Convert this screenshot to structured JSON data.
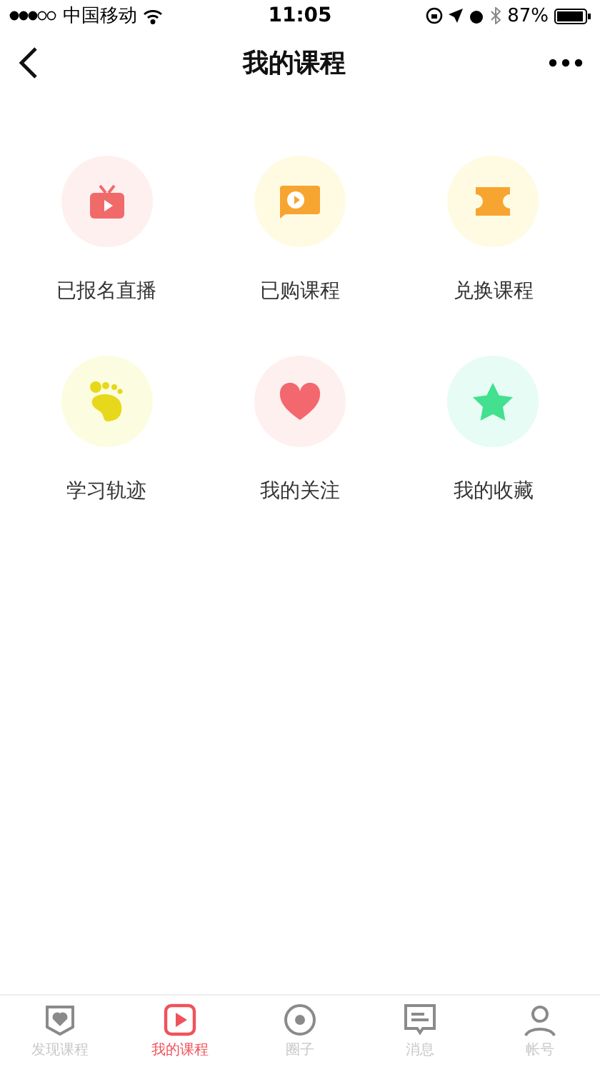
{
  "status_bar": {
    "carrier": "中国移动",
    "time": "11:05",
    "battery": "87%"
  },
  "nav": {
    "title": "我的课程"
  },
  "menu": [
    {
      "kind": "tv",
      "label": "已报名直播",
      "color": "#fff0f0"
    },
    {
      "kind": "video",
      "label": "已购课程",
      "color": "#fffbe3"
    },
    {
      "kind": "ticket",
      "label": "兑换课程",
      "color": "#fffbe3"
    },
    {
      "kind": "foot",
      "label": "学习轨迹",
      "color": "#fcfde0"
    },
    {
      "kind": "heart",
      "label": "我的关注",
      "color": "#fff0f0"
    },
    {
      "kind": "star",
      "label": "我的收藏",
      "color": "#e6fcf4"
    }
  ],
  "tabs": [
    {
      "kind": "discover",
      "label": "发现课程",
      "selected": false
    },
    {
      "kind": "course",
      "label": "我的课程",
      "selected": true
    },
    {
      "kind": "circle",
      "label": "圈子",
      "selected": false
    },
    {
      "kind": "message",
      "label": "消息",
      "selected": false
    },
    {
      "kind": "account",
      "label": "帐号",
      "selected": false
    }
  ]
}
